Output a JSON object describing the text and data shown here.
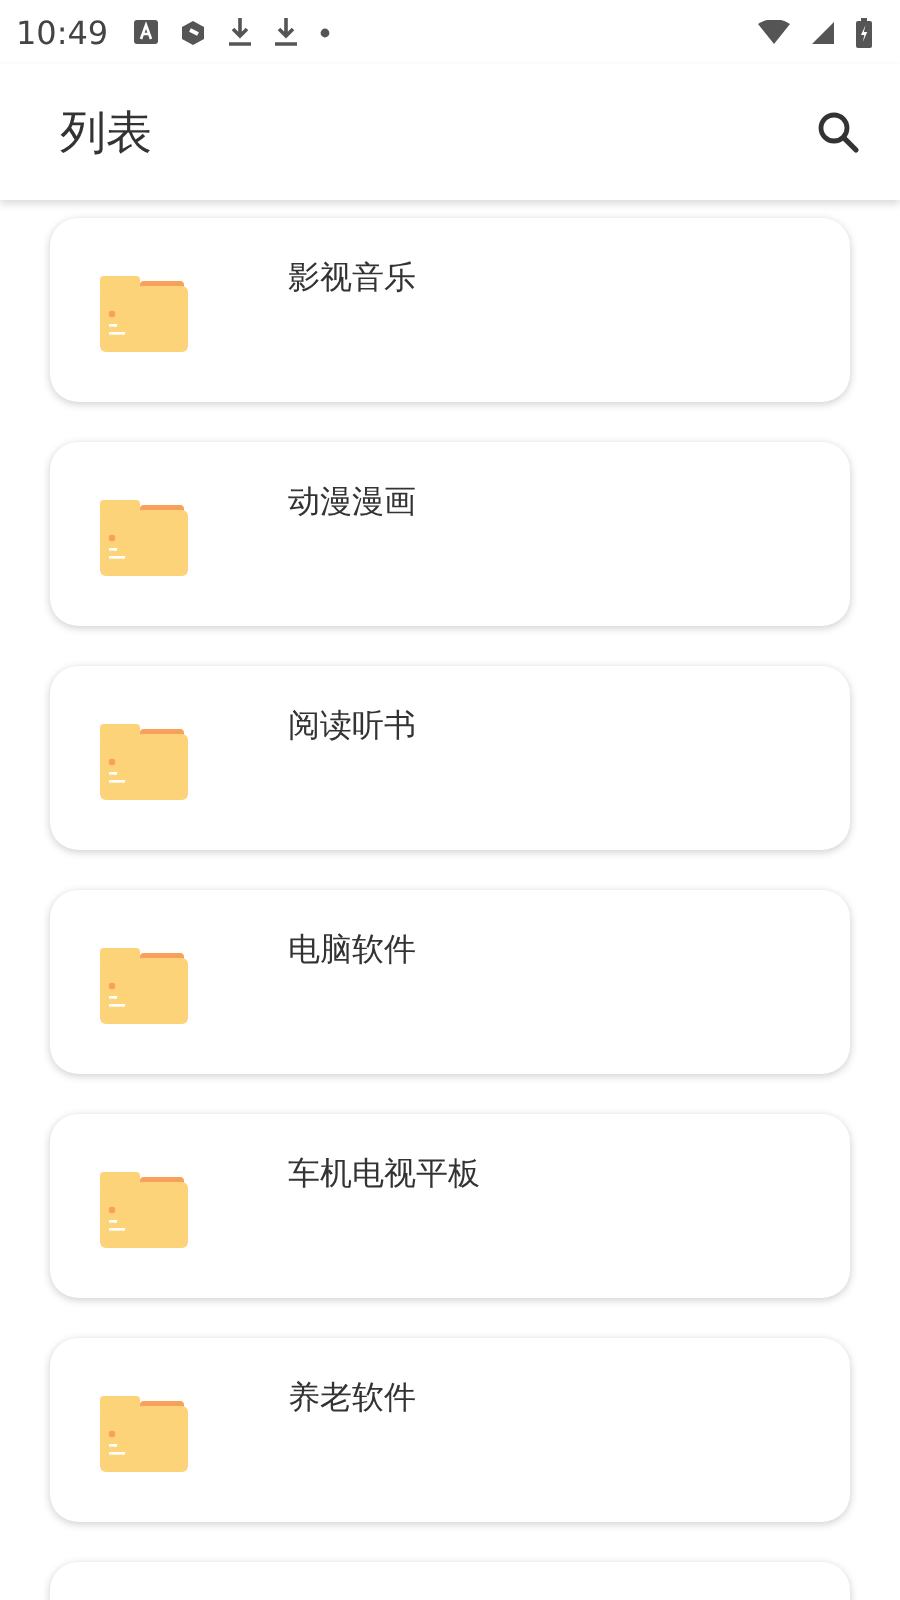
{
  "status_bar": {
    "time": "10:49"
  },
  "app_bar": {
    "title": "列表"
  },
  "items": [
    {
      "title": "影视音乐"
    },
    {
      "title": "动漫漫画"
    },
    {
      "title": "阅读听书"
    },
    {
      "title": "电脑软件"
    },
    {
      "title": "车机电视平板"
    },
    {
      "title": "养老软件"
    }
  ]
}
